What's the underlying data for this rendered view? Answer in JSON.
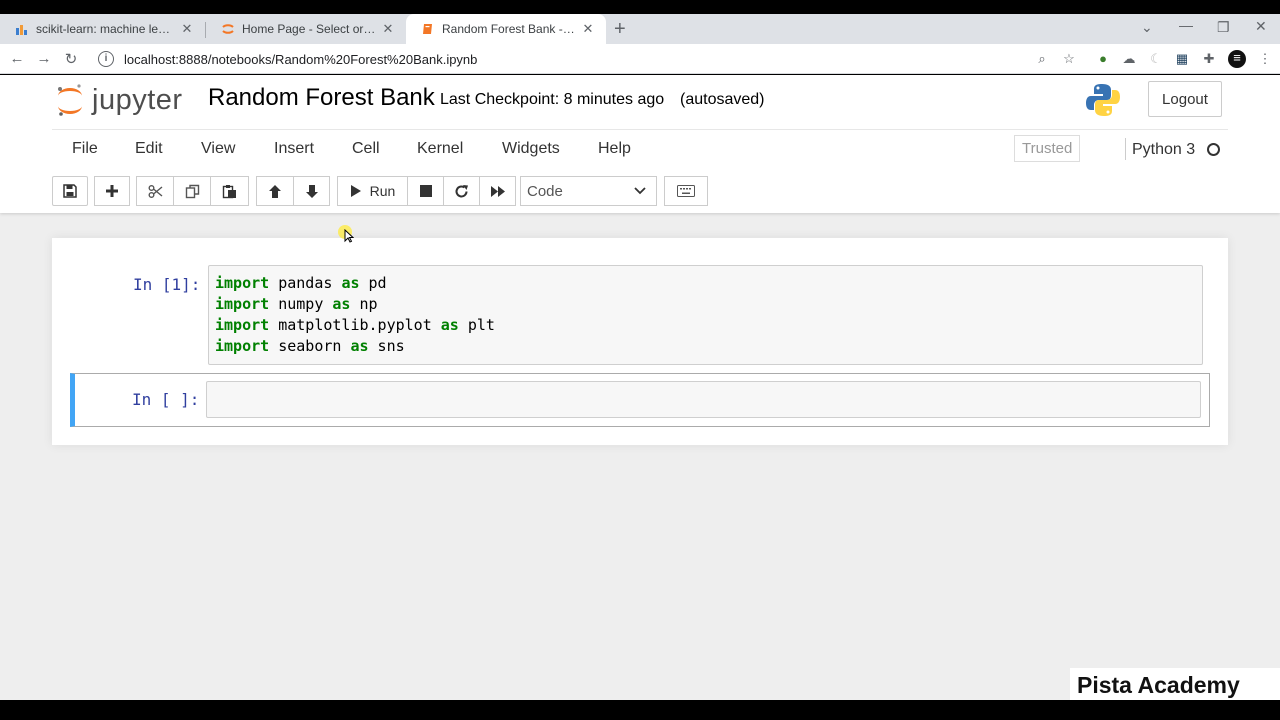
{
  "browser": {
    "tabs": [
      {
        "title": "scikit-learn: machine learning in Python",
        "active": false
      },
      {
        "title": "Home Page - Select or create a notebook",
        "active": false
      },
      {
        "title": "Random Forest Bank - Jupyter Notebook",
        "active": true
      }
    ],
    "url": "localhost:8888/notebooks/Random%20Forest%20Bank.ipynb"
  },
  "jupyter": {
    "logo_text": "jupyter",
    "notebook_title": "Random Forest Bank",
    "checkpoint": "Last Checkpoint: 8 minutes ago",
    "autosave": "(autosaved)",
    "logout_label": "Logout",
    "menu": [
      "File",
      "Edit",
      "View",
      "Insert",
      "Cell",
      "Kernel",
      "Widgets",
      "Help"
    ],
    "trusted_label": "Trusted",
    "kernel_name": "Python 3",
    "run_label": "Run",
    "cell_type": "Code"
  },
  "cells": [
    {
      "prompt": "In [1]:",
      "lines": [
        {
          "kw": "import",
          "rest1": " pandas ",
          "kw2": "as",
          "rest2": " pd"
        },
        {
          "kw": "import",
          "rest1": " numpy ",
          "kw2": "as",
          "rest2": " np"
        },
        {
          "kw": "import",
          "rest1": " matplotlib.pyplot ",
          "kw2": "as",
          "rest2": " plt"
        },
        {
          "kw": "import",
          "rest1": " seaborn ",
          "kw2": "as",
          "rest2": " sns"
        }
      ]
    },
    {
      "prompt": "In [ ]:",
      "lines": []
    }
  ],
  "watermark": "Pista Academy",
  "colors": {
    "accent": "#42a5f5",
    "keyword": "#008000",
    "prompt": "#303f9f"
  }
}
